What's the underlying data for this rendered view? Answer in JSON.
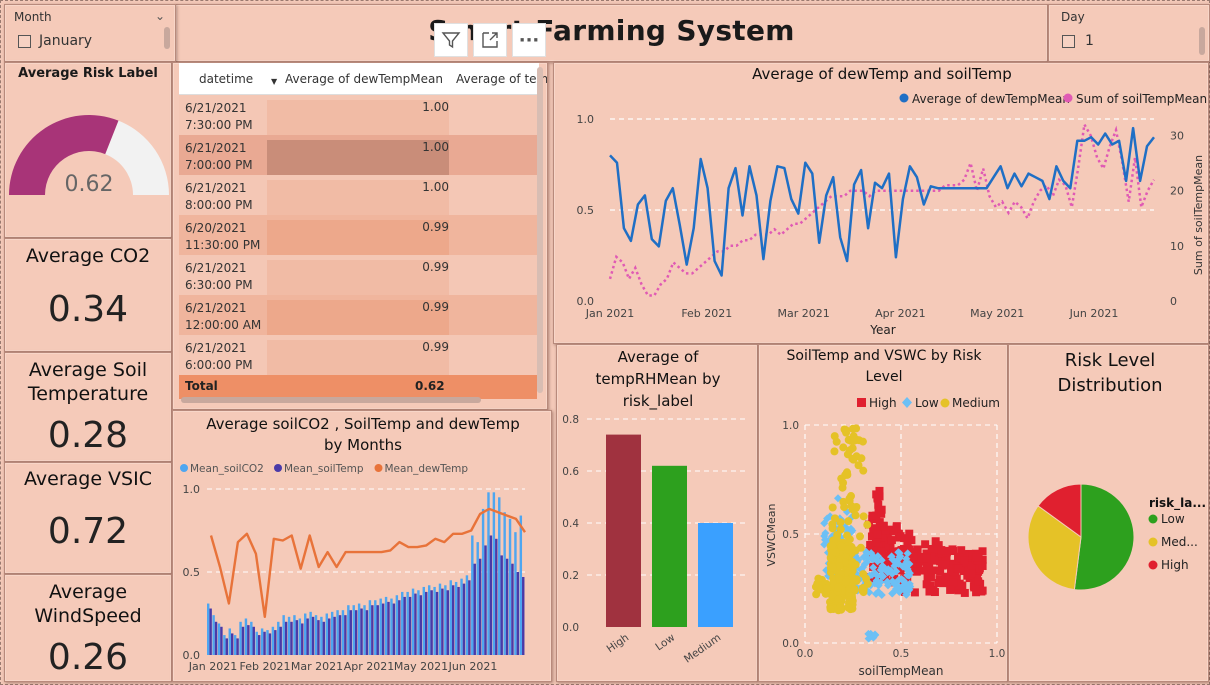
{
  "header": {
    "title": "Smart Farming System"
  },
  "slicers": {
    "month": {
      "label": "Month",
      "value": "January"
    },
    "day": {
      "label": "Day",
      "value": "1"
    }
  },
  "gauge": {
    "title": "Average Risk Label",
    "value": "0.62",
    "fraction": 0.62,
    "colors": {
      "fill": "#a83478",
      "track": "#f2f2f2"
    }
  },
  "kpis": [
    {
      "title": "Average CO2",
      "value": "0.34"
    },
    {
      "title": "Average Soil Temperature",
      "value": "0.28"
    },
    {
      "title": "Average VSIC",
      "value": "0.72"
    },
    {
      "title": "Average WindSpeed",
      "value": "0.26"
    }
  ],
  "table": {
    "columns": [
      "datetime",
      "Average of dewTempMean",
      "Average of tem"
    ],
    "rows": [
      {
        "date": "6/21/2021",
        "time": "7:30:00 PM",
        "value": "1.00"
      },
      {
        "date": "6/21/2021",
        "time": "7:00:00 PM",
        "value": "1.00"
      },
      {
        "date": "6/21/2021",
        "time": "8:00:00 PM",
        "value": "1.00"
      },
      {
        "date": "6/20/2021",
        "time": "11:30:00 PM",
        "value": "0.99"
      },
      {
        "date": "6/21/2021",
        "time": "6:30:00 PM",
        "value": "0.99"
      },
      {
        "date": "6/21/2021",
        "time": "12:00:00 AM",
        "value": "0.99"
      },
      {
        "date": "6/21/2021",
        "time": "6:00:00 PM",
        "value": "0.99"
      }
    ],
    "total_label": "Total",
    "total_value": "0.62"
  },
  "toolbar": {
    "filter_icon": "filter-icon",
    "focus_icon": "focus-mode-icon",
    "more_label": "···"
  },
  "chart_data": [
    {
      "id": "dew_soil",
      "type": "line",
      "title": "Average of dewTemp and soilTemp",
      "xlabel": "Year",
      "ylabel": "",
      "y2label": "Sum of soilTempMean",
      "x_ticks": [
        "Jan 2021",
        "Feb 2021",
        "Mar 2021",
        "Apr 2021",
        "May 2021",
        "Jun 2021"
      ],
      "y_ticks": [
        "0.0",
        "0.5",
        "1.0"
      ],
      "y2_ticks": [
        "0",
        "10",
        "20",
        "30"
      ],
      "ylim": [
        0,
        1
      ],
      "y2lim": [
        0,
        33
      ],
      "legend": "top-right",
      "series": [
        {
          "name": "Average of dewTempMean",
          "color": "#1f6fc5",
          "style": "solid",
          "values": [
            0.8,
            0.76,
            0.4,
            0.33,
            0.53,
            0.58,
            0.34,
            0.3,
            0.55,
            0.62,
            0.42,
            0.2,
            0.4,
            0.78,
            0.62,
            0.22,
            0.14,
            0.62,
            0.73,
            0.47,
            0.74,
            0.58,
            0.23,
            0.55,
            0.74,
            0.73,
            0.56,
            0.48,
            0.76,
            0.7,
            0.32,
            0.58,
            0.68,
            0.35,
            0.22,
            0.64,
            0.72,
            0.4,
            0.65,
            0.62,
            0.7,
            0.24,
            0.56,
            0.74,
            0.68,
            0.53,
            0.63,
            0.62,
            0.62,
            0.62,
            0.62,
            0.62,
            0.62,
            0.62,
            0.62,
            0.68,
            0.74,
            0.62,
            0.7,
            0.63,
            0.7,
            0.68,
            0.66,
            0.56,
            0.74,
            0.66,
            0.62,
            0.88,
            0.88,
            0.9,
            0.86,
            0.92,
            0.86,
            0.88,
            0.66,
            0.95,
            0.66,
            0.85,
            0.9
          ]
        },
        {
          "name": "Sum of soilTempMean",
          "color": "#e05ab4",
          "style": "dotted",
          "values": [
            4,
            8,
            7,
            4,
            6,
            3,
            1,
            1,
            3,
            4,
            7,
            6,
            5,
            5,
            6,
            7,
            8,
            9,
            9,
            10,
            10,
            11,
            11,
            12,
            12,
            12,
            13,
            12,
            13,
            14,
            14,
            15,
            16,
            17,
            18,
            19,
            19,
            19,
            20,
            20,
            20,
            19,
            20,
            20,
            20,
            20,
            20,
            20,
            20,
            20,
            20,
            20,
            20,
            21,
            21,
            21,
            22,
            25,
            20,
            24,
            19,
            17,
            18,
            16,
            18,
            17,
            15,
            18,
            20,
            21,
            19,
            22,
            21,
            17,
            24,
            32,
            30,
            26,
            24,
            28,
            31,
            25,
            18,
            26,
            17,
            20,
            22
          ]
        }
      ]
    },
    {
      "id": "soil_months",
      "type": "bar",
      "title": "Average soilCO2 , SoilTemp and dewTemp by Months",
      "x_ticks": [
        "Jan 2021",
        "Feb 2021",
        "Mar 2021",
        "Apr 2021",
        "May 2021",
        "Jun 2021"
      ],
      "y_ticks": [
        "0.0",
        "0.5",
        "1.0"
      ],
      "ylim": [
        0,
        1
      ],
      "legend": "top-left",
      "series": [
        {
          "name": "Mean_soilCO2",
          "color": "#4ea6f0",
          "kind": "bar",
          "values": [
            0.31,
            0.24,
            0.19,
            0.12,
            0.16,
            0.12,
            0.2,
            0.22,
            0.2,
            0.14,
            0.16,
            0.15,
            0.17,
            0.2,
            0.24,
            0.23,
            0.24,
            0.22,
            0.25,
            0.26,
            0.24,
            0.23,
            0.25,
            0.26,
            0.27,
            0.27,
            0.3,
            0.3,
            0.31,
            0.3,
            0.33,
            0.33,
            0.34,
            0.35,
            0.34,
            0.36,
            0.38,
            0.38,
            0.4,
            0.39,
            0.41,
            0.42,
            0.41,
            0.43,
            0.42,
            0.45,
            0.44,
            0.46,
            0.48,
            0.72,
            0.68,
            0.88,
            0.98,
            0.98,
            0.95,
            0.86,
            0.82,
            0.74,
            0.84
          ]
        },
        {
          "name": "Mean_soilTemp",
          "color": "#4a3aa8",
          "kind": "bar",
          "values": [
            0.28,
            0.2,
            0.17,
            0.1,
            0.13,
            0.1,
            0.17,
            0.18,
            0.17,
            0.12,
            0.14,
            0.13,
            0.15,
            0.17,
            0.2,
            0.2,
            0.21,
            0.19,
            0.22,
            0.23,
            0.21,
            0.2,
            0.22,
            0.23,
            0.24,
            0.24,
            0.27,
            0.27,
            0.28,
            0.27,
            0.3,
            0.3,
            0.31,
            0.32,
            0.31,
            0.33,
            0.35,
            0.35,
            0.37,
            0.36,
            0.38,
            0.39,
            0.38,
            0.4,
            0.39,
            0.42,
            0.41,
            0.43,
            0.45,
            0.55,
            0.58,
            0.66,
            0.72,
            0.7,
            0.6,
            0.58,
            0.55,
            0.5,
            0.47
          ]
        },
        {
          "name": "Mean_dewTemp",
          "color": "#e8733a",
          "kind": "line",
          "values": [
            0.72,
            0.53,
            0.31,
            0.68,
            0.73,
            0.61,
            0.23,
            0.7,
            0.69,
            0.72,
            0.52,
            0.72,
            0.53,
            0.62,
            0.53,
            0.62,
            0.62,
            0.62,
            0.62,
            0.62,
            0.63,
            0.68,
            0.65,
            0.65,
            0.66,
            0.7,
            0.68,
            0.73,
            0.73,
            0.75,
            0.85,
            0.88,
            0.86,
            0.84,
            0.82,
            0.74
          ]
        }
      ]
    },
    {
      "id": "rh_risk",
      "type": "bar",
      "title": "Average of tempRHMean by risk_label",
      "categories": [
        "High",
        "Low",
        "Medium"
      ],
      "values": [
        0.74,
        0.62,
        0.4
      ],
      "colors": [
        "#a0323f",
        "#2da01e",
        "#3aa0ff"
      ],
      "y_ticks": [
        "0.0",
        "0.2",
        "0.4",
        "0.6",
        "0.8"
      ],
      "ylim": [
        0,
        0.8
      ]
    },
    {
      "id": "scatter_risk",
      "type": "scatter",
      "title": "SoilTemp and VSWC by Risk Level",
      "xlabel": "soilTempMean",
      "ylabel": "VSWCMean",
      "x_ticks": [
        "0.0",
        "0.5",
        "1.0"
      ],
      "y_ticks": [
        "0.0",
        "0.5",
        "1.0"
      ],
      "xlim": [
        0,
        1
      ],
      "ylim": [
        0,
        1
      ],
      "legend": "top",
      "series": [
        {
          "name": "High",
          "color": "#e0202f"
        },
        {
          "name": "Low",
          "color": "#6cc0f5"
        },
        {
          "name": "Medium",
          "color": "#e5c227"
        }
      ]
    },
    {
      "id": "risk_pie",
      "type": "pie",
      "title": "Risk Level Distribution",
      "legend_title": "risk_la...",
      "slices": [
        {
          "name": "Low",
          "label": "Low",
          "value": 0.52,
          "color": "#2da01e"
        },
        {
          "name": "Medium",
          "label": "Med...",
          "value": 0.33,
          "color": "#e5c227"
        },
        {
          "name": "High",
          "label": "High",
          "value": 0.15,
          "color": "#e0202f"
        }
      ]
    }
  ]
}
